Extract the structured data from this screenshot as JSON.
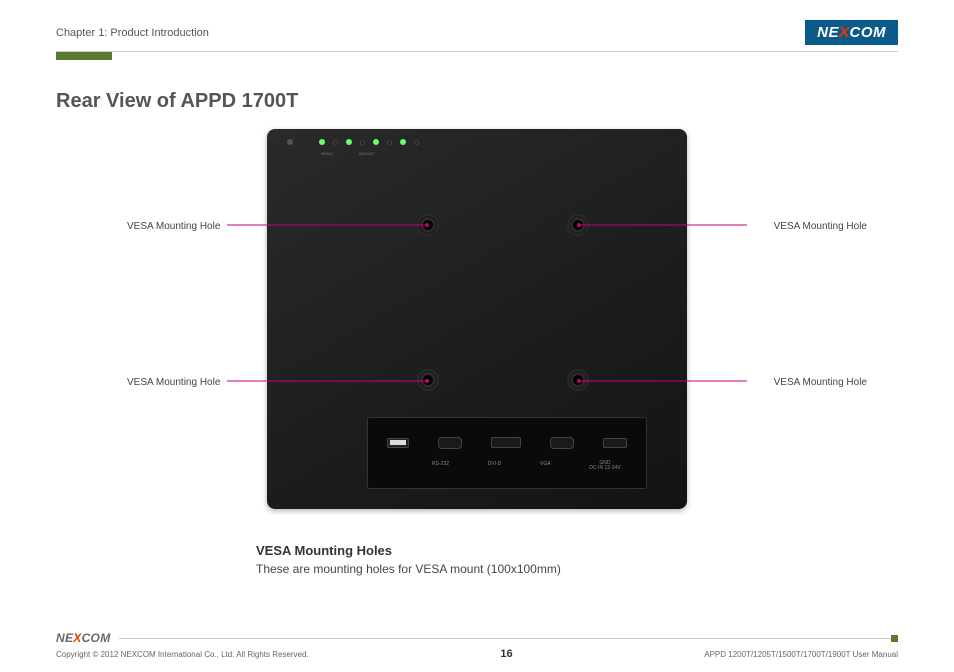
{
  "header": {
    "chapter": "Chapter 1: Product Introduction",
    "brand_pre": "NE",
    "brand_x": "X",
    "brand_post": "COM"
  },
  "title": "Rear View of APPD 1700T",
  "callouts": {
    "top_left": "VESA Mounting Hole",
    "top_right": "VESA Mounting Hole",
    "bottom_left": "VESA Mounting Hole",
    "bottom_right": "VESA Mounting Hole"
  },
  "top_labels": {
    "menu": "MENU",
    "adjust": "ADJUST"
  },
  "io": {
    "usb": "",
    "rs232": "RS-232",
    "dvi": "DVI-D",
    "vga": "VGA",
    "pwr": "GND\nDC-IN 12-24V"
  },
  "desc": {
    "heading": "VESA Mounting Holes",
    "text": "These are mounting holes for VESA mount (100x100mm)"
  },
  "footer": {
    "copyright": "Copyright © 2012 NEXCOM International Co., Ltd. All Rights Reserved.",
    "page": "16",
    "doc": "APPD 1200T/1205T/1500T/1700T/1900T User Manual"
  }
}
